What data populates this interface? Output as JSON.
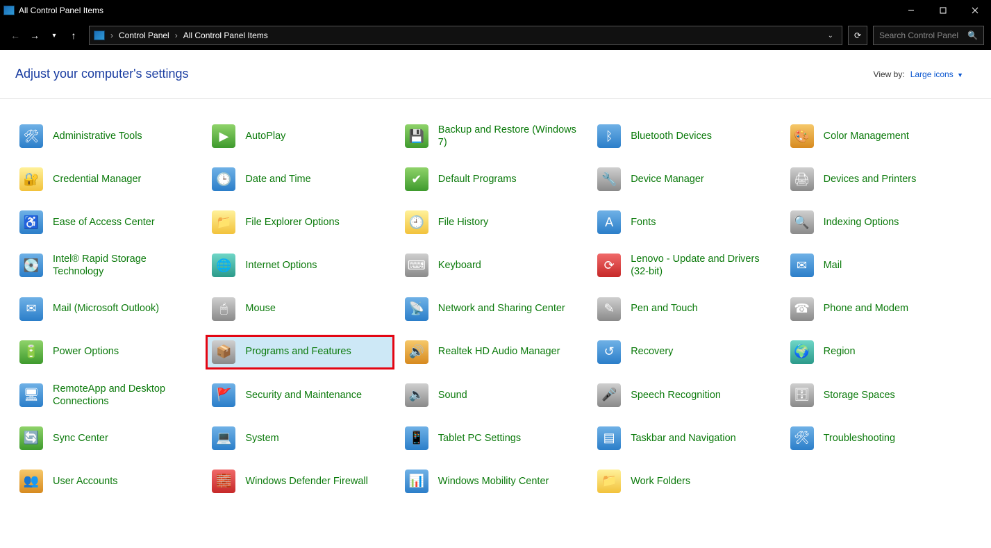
{
  "window": {
    "title": "All Control Panel Items"
  },
  "breadcrumb": {
    "root": "Control Panel",
    "current": "All Control Panel Items"
  },
  "search": {
    "placeholder": "Search Control Panel"
  },
  "header": {
    "title": "Adjust your computer's settings",
    "viewby_label": "View by:",
    "viewby_value": "Large icons"
  },
  "items": [
    {
      "label": "Administrative Tools",
      "icon": "ic-blue",
      "glyph": "🛠"
    },
    {
      "label": "AutoPlay",
      "icon": "ic-green",
      "glyph": "▶"
    },
    {
      "label": "Backup and Restore (Windows 7)",
      "icon": "ic-green",
      "glyph": "💾"
    },
    {
      "label": "Bluetooth Devices",
      "icon": "ic-blue",
      "glyph": "ᛒ"
    },
    {
      "label": "Color Management",
      "icon": "ic-orange",
      "glyph": "🎨"
    },
    {
      "label": "Credential Manager",
      "icon": "ic-yellow",
      "glyph": "🔐"
    },
    {
      "label": "Date and Time",
      "icon": "ic-blue",
      "glyph": "🕒"
    },
    {
      "label": "Default Programs",
      "icon": "ic-green",
      "glyph": "✔"
    },
    {
      "label": "Device Manager",
      "icon": "ic-gray",
      "glyph": "🔧"
    },
    {
      "label": "Devices and Printers",
      "icon": "ic-gray",
      "glyph": "🖨"
    },
    {
      "label": "Ease of Access Center",
      "icon": "ic-blue",
      "glyph": "♿"
    },
    {
      "label": "File Explorer Options",
      "icon": "ic-yellow",
      "glyph": "📁"
    },
    {
      "label": "File History",
      "icon": "ic-yellow",
      "glyph": "🕘"
    },
    {
      "label": "Fonts",
      "icon": "ic-blue",
      "glyph": "A"
    },
    {
      "label": "Indexing Options",
      "icon": "ic-gray",
      "glyph": "🔍"
    },
    {
      "label": "Intel® Rapid Storage Technology",
      "icon": "ic-blue",
      "glyph": "💽"
    },
    {
      "label": "Internet Options",
      "icon": "ic-teal",
      "glyph": "🌐"
    },
    {
      "label": "Keyboard",
      "icon": "ic-gray",
      "glyph": "⌨"
    },
    {
      "label": "Lenovo - Update and Drivers (32-bit)",
      "icon": "ic-red",
      "glyph": "⟳"
    },
    {
      "label": "Mail",
      "icon": "ic-blue",
      "glyph": "✉"
    },
    {
      "label": "Mail (Microsoft Outlook)",
      "icon": "ic-blue",
      "glyph": "✉"
    },
    {
      "label": "Mouse",
      "icon": "ic-gray",
      "glyph": "🖱"
    },
    {
      "label": "Network and Sharing Center",
      "icon": "ic-blue",
      "glyph": "📡"
    },
    {
      "label": "Pen and Touch",
      "icon": "ic-gray",
      "glyph": "✎"
    },
    {
      "label": "Phone and Modem",
      "icon": "ic-gray",
      "glyph": "☎"
    },
    {
      "label": "Power Options",
      "icon": "ic-green",
      "glyph": "🔋"
    },
    {
      "label": "Programs and Features",
      "icon": "ic-gray",
      "glyph": "📦",
      "highlight": true
    },
    {
      "label": "Realtek HD Audio Manager",
      "icon": "ic-orange",
      "glyph": "🔊"
    },
    {
      "label": "Recovery",
      "icon": "ic-blue",
      "glyph": "↺"
    },
    {
      "label": "Region",
      "icon": "ic-teal",
      "glyph": "🌍"
    },
    {
      "label": "RemoteApp and Desktop Connections",
      "icon": "ic-blue",
      "glyph": "🖥"
    },
    {
      "label": "Security and Maintenance",
      "icon": "ic-blue",
      "glyph": "🚩"
    },
    {
      "label": "Sound",
      "icon": "ic-gray",
      "glyph": "🔈"
    },
    {
      "label": "Speech Recognition",
      "icon": "ic-gray",
      "glyph": "🎤"
    },
    {
      "label": "Storage Spaces",
      "icon": "ic-gray",
      "glyph": "🗄"
    },
    {
      "label": "Sync Center",
      "icon": "ic-green",
      "glyph": "🔄"
    },
    {
      "label": "System",
      "icon": "ic-blue",
      "glyph": "💻"
    },
    {
      "label": "Tablet PC Settings",
      "icon": "ic-blue",
      "glyph": "📱"
    },
    {
      "label": "Taskbar and Navigation",
      "icon": "ic-blue",
      "glyph": "▤"
    },
    {
      "label": "Troubleshooting",
      "icon": "ic-blue",
      "glyph": "🛠"
    },
    {
      "label": "User Accounts",
      "icon": "ic-orange",
      "glyph": "👥"
    },
    {
      "label": "Windows Defender Firewall",
      "icon": "ic-red",
      "glyph": "🧱"
    },
    {
      "label": "Windows Mobility Center",
      "icon": "ic-blue",
      "glyph": "📊"
    },
    {
      "label": "Work Folders",
      "icon": "ic-yellow",
      "glyph": "📁"
    }
  ]
}
